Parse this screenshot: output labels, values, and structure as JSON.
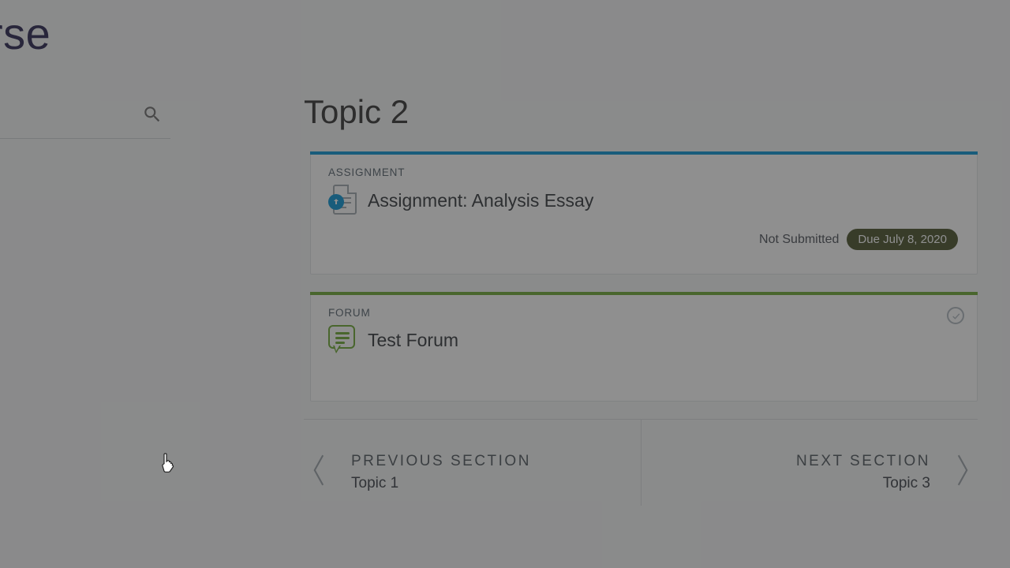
{
  "header": {
    "title_fragment": "Test Course"
  },
  "main": {
    "topic_title": "Topic 2",
    "items": [
      {
        "type_label": "ASSIGNMENT",
        "title": "Assignment: Analysis Essay",
        "status": "Not Submitted",
        "due": "Due July 8, 2020"
      },
      {
        "type_label": "FORUM",
        "title": "Test Forum"
      }
    ]
  },
  "nav": {
    "prev": {
      "eyebrow": "PREVIOUS SECTION",
      "topic": "Topic 1"
    },
    "next": {
      "eyebrow": "NEXT SECTION",
      "topic": "Topic 3"
    }
  },
  "colors": {
    "assignment_accent": "#1d9dd8",
    "forum_accent": "#79b043",
    "due_pill": "#58613d"
  }
}
